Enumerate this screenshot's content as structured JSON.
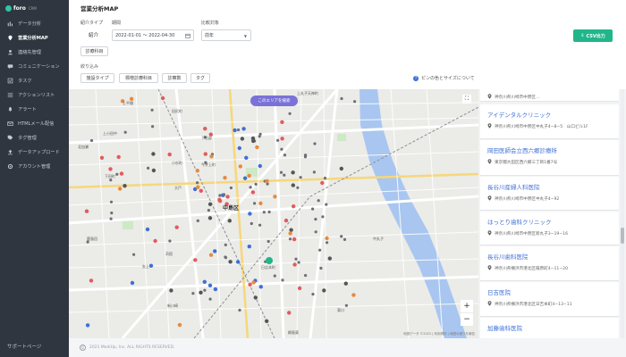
{
  "brand": {
    "name": "foro",
    "sub": "CRM"
  },
  "sidebar": {
    "items": [
      {
        "label": "データ分析",
        "icon": "chart-icon",
        "active": false
      },
      {
        "label": "営業分析MAP",
        "icon": "map-pin-icon",
        "active": true
      },
      {
        "label": "連絡先管理",
        "icon": "contacts-icon",
        "active": false
      },
      {
        "label": "コミュニケーション",
        "icon": "chat-icon",
        "active": false
      },
      {
        "label": "タスク",
        "icon": "task-icon",
        "active": false
      },
      {
        "label": "アクションリスト",
        "icon": "list-icon",
        "active": false
      },
      {
        "label": "アラート",
        "icon": "bell-icon",
        "active": false
      },
      {
        "label": "HTMLメール配信",
        "icon": "mail-icon",
        "active": false
      },
      {
        "label": "タグ管理",
        "icon": "tag-icon",
        "active": false
      },
      {
        "label": "データアップロード",
        "icon": "upload-icon",
        "active": false
      },
      {
        "label": "アカウント管理",
        "icon": "gear-icon",
        "active": false
      }
    ],
    "support": "サポートページ"
  },
  "header": {
    "title": "営業分析MAP"
  },
  "filters": {
    "intro_type_label": "紹介タイプ",
    "intro_type_value": "紹介",
    "period_label": "期間",
    "period_value": "2022-01-01 ～ 2022-04-30",
    "target_label": "比較対象",
    "target_value": "前年",
    "dept_button": "診療科目",
    "narrow_label": "絞り込み",
    "chips": [
      "施設タイプ",
      "標榜診療科目",
      "診察数",
      "タグ"
    ],
    "pin_help": "ピンの色とサイズについて",
    "csv_button": "CSV出力"
  },
  "map": {
    "area_search": "このエリアを検索",
    "labels": [
      {
        "text": "中島区",
        "big": true
      },
      {
        "text": "上平間"
      },
      {
        "text": "田尻町"
      },
      {
        "text": "上丸子天神町"
      },
      {
        "text": "上小田中"
      },
      {
        "text": "北加瀬"
      },
      {
        "text": "小杉町"
      },
      {
        "text": "今井上町"
      },
      {
        "text": "下沼部"
      },
      {
        "text": "大戸"
      },
      {
        "text": "苅宿"
      },
      {
        "text": "中丸子"
      },
      {
        "text": "新川崎"
      },
      {
        "text": "鹿島田"
      },
      {
        "text": "矢上"
      },
      {
        "text": "日吉本町"
      },
      {
        "text": "下田町"
      },
      {
        "text": "東口"
      },
      {
        "text": "綱島東"
      }
    ],
    "attribution": "地図データ ©2022 | 利用規約 | 地図の誤りを報告"
  },
  "clinics": [
    {
      "name": "",
      "address": "神奈川県川崎市中原区..."
    },
    {
      "name": "アイデンタルクリニック",
      "address": "神奈川県川崎市中原区中丸子4−8−5　山口ビル1F"
    },
    {
      "name": "岡田医師会立西六郷診療所",
      "address": "東京都大田区西六郷三丁目1番7号"
    },
    {
      "name": "長谷川産婦人科医院",
      "address": "神奈川県川崎市中原区中丸子4−92"
    },
    {
      "name": "はっとり歯科クリニック",
      "address": "神奈川県川崎市中原区新丸子3−19−16"
    },
    {
      "name": "長谷川歯科医院",
      "address": "神奈川県横浜市港北区篠原町4−11−20"
    },
    {
      "name": "日吉医院",
      "address": "神奈川県横浜市港北区日吉本町4−13−11"
    },
    {
      "name": "加藤歯科医院",
      "address": ""
    }
  ],
  "footer": {
    "copyright": "2021 MediUp, Inc. ALL RIGHTS RESERVED."
  }
}
